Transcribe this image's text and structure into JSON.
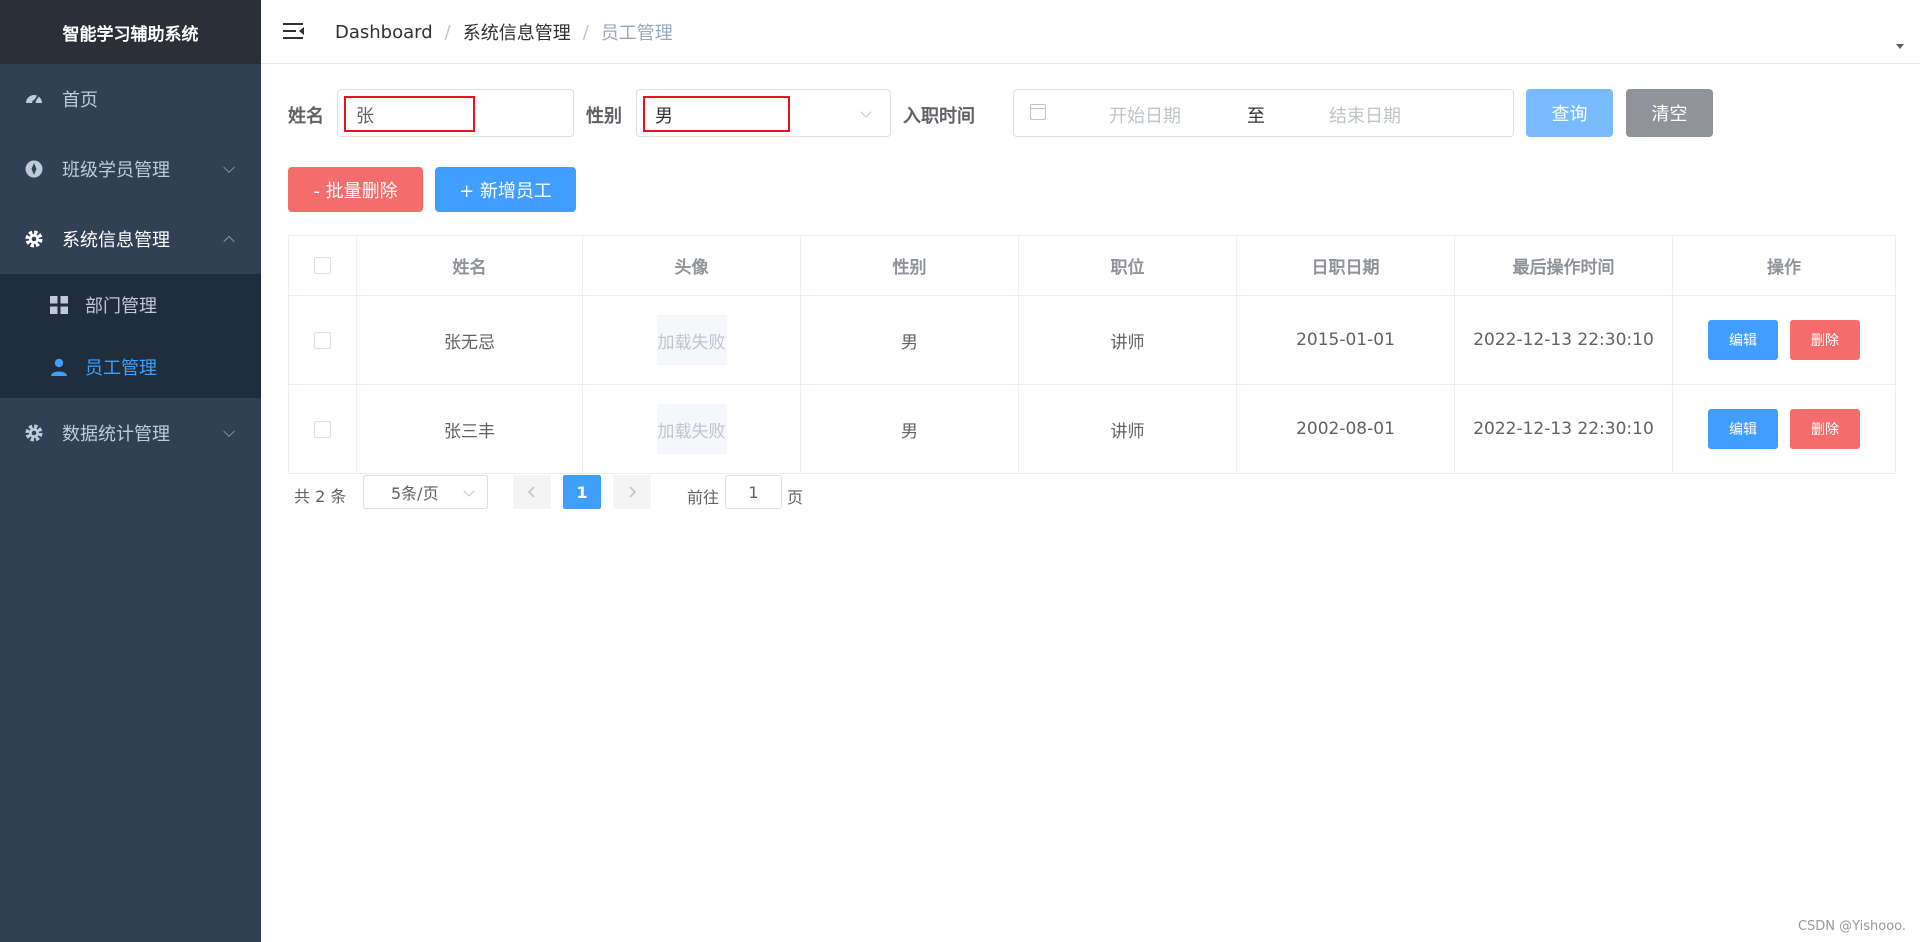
{
  "app": {
    "title": "智能学习辅助系统"
  },
  "sidebar": {
    "items": [
      {
        "label": "首页",
        "icon": "dashboard-icon"
      },
      {
        "label": "班级学员管理",
        "icon": "compass-icon"
      },
      {
        "label": "系统信息管理",
        "icon": "gear-icon",
        "expanded": true,
        "children": [
          {
            "label": "部门管理",
            "icon": "grid-icon"
          },
          {
            "label": "员工管理",
            "icon": "user-icon",
            "active": true
          }
        ]
      },
      {
        "label": "数据统计管理",
        "icon": "gear-icon"
      }
    ]
  },
  "header": {
    "breadcrumb": [
      "Dashboard",
      "系统信息管理",
      "员工管理"
    ],
    "separator": "/"
  },
  "search": {
    "name_label": "姓名",
    "name_value": "张",
    "gender_label": "性别",
    "gender_value": "男",
    "entry_label": "入职时间",
    "start_placeholder": "开始日期",
    "range_separator": "至",
    "end_placeholder": "结束日期",
    "query_button": "查询",
    "clear_button": "清空"
  },
  "actions": {
    "batch_delete": "- 批量删除",
    "add_employee": "+ 新增员工"
  },
  "table": {
    "columns": [
      "姓名",
      "头像",
      "性别",
      "职位",
      "日职日期",
      "最后操作时间",
      "操作"
    ],
    "rows": [
      {
        "name": "张无忌",
        "avatar": "加载失败",
        "gender": "男",
        "job": "讲师",
        "entry_date": "2015-01-01",
        "update_time": "2022-12-13 22:30:10"
      },
      {
        "name": "张三丰",
        "avatar": "加载失败",
        "gender": "男",
        "job": "讲师",
        "entry_date": "2002-08-01",
        "update_time": "2022-12-13 22:30:10"
      }
    ],
    "edit_label": "编辑",
    "delete_label": "删除"
  },
  "pagination": {
    "total": "共 2 条",
    "page_size": "5条/页",
    "current_page": "1",
    "goto_prefix": "前往",
    "goto_value": "1",
    "goto_suffix": "页"
  },
  "watermark": "CSDN @Yishooo.",
  "colors": {
    "primary": "#409eff",
    "danger": "#f56c6c",
    "sidebar": "#304156"
  }
}
